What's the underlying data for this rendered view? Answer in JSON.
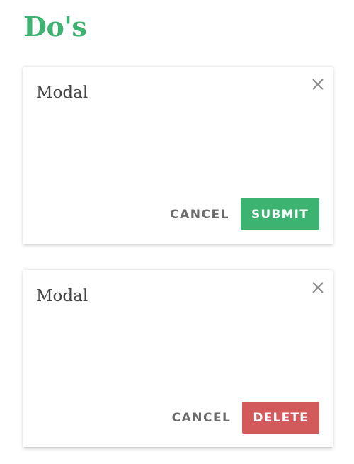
{
  "page": {
    "title": "Do's",
    "title_color": "#3cb371"
  },
  "modals": [
    {
      "title": "Modal",
      "close_icon": "close-icon",
      "cancel_label": "CANCEL",
      "primary_label": "SUBMIT",
      "primary_color": "#3cb371"
    },
    {
      "title": "Modal",
      "close_icon": "close-icon",
      "cancel_label": "CANCEL",
      "primary_label": "DELETE",
      "primary_color": "#d35a5a"
    }
  ]
}
